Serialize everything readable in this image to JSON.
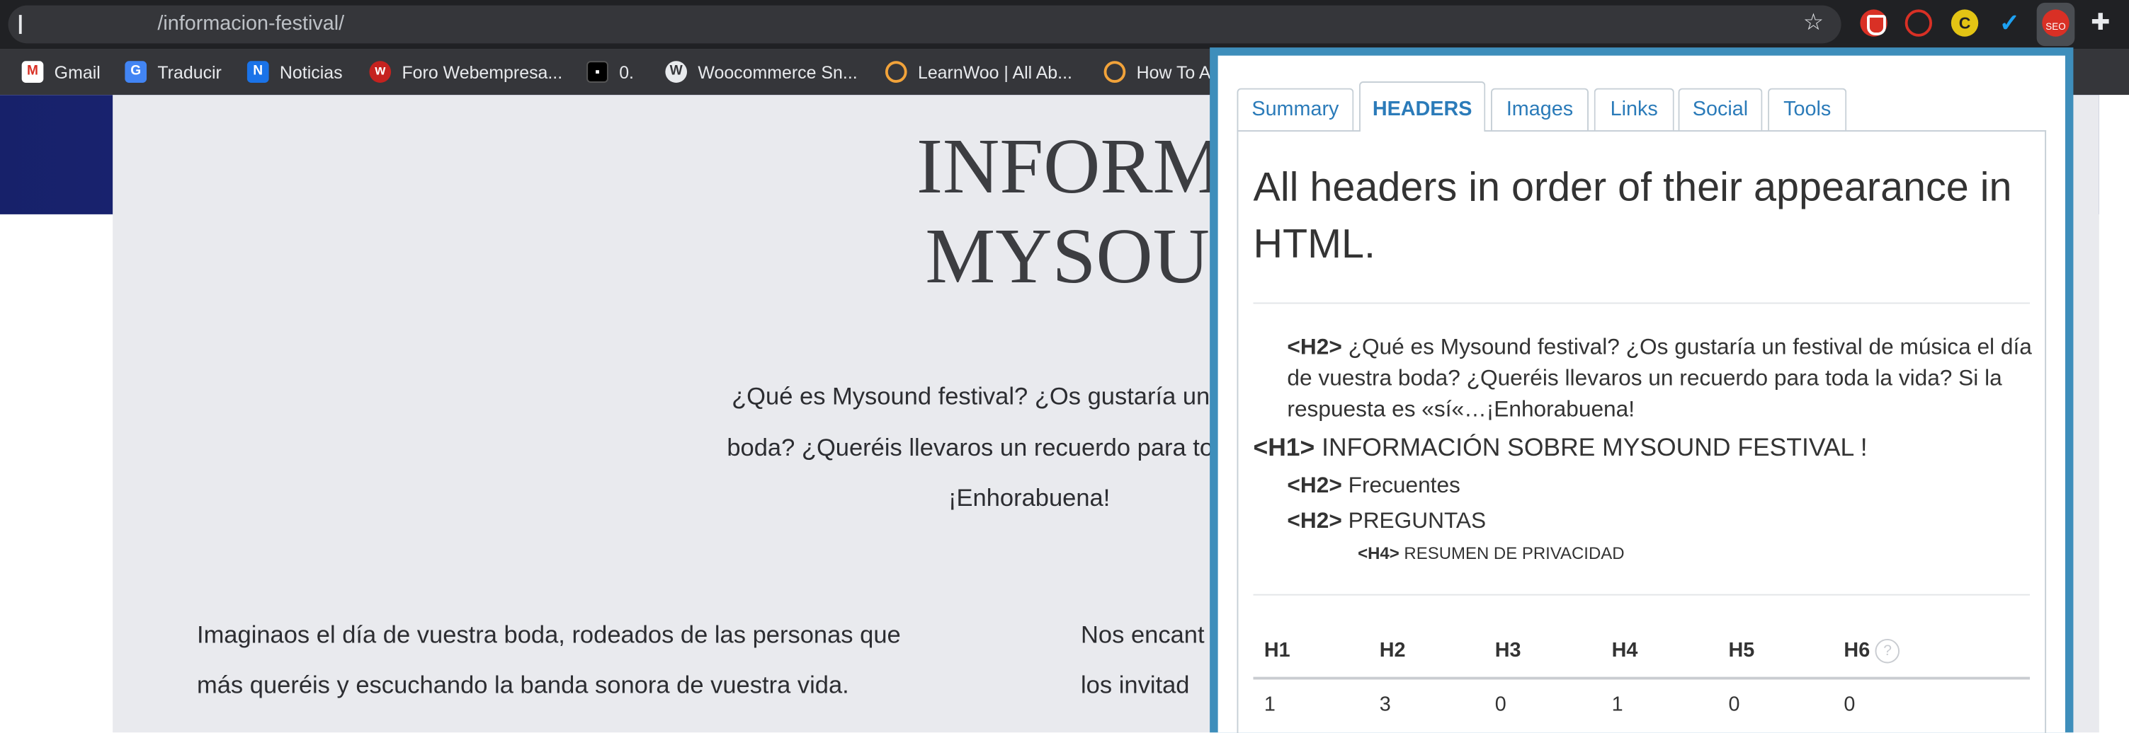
{
  "browser": {
    "url": "/informacion-festival/",
    "icons": [
      "star-icon",
      "brave-shield-icon",
      "search-extension-icon",
      "c-extension-icon",
      "check-extension-icon",
      "seo-extension-icon",
      "puzzle-icon"
    ]
  },
  "bookmarks": [
    {
      "label": "Gmail",
      "icon": "gmail-icon"
    },
    {
      "label": "Traducir",
      "icon": "translate-icon"
    },
    {
      "label": "Noticias",
      "icon": "news-icon"
    },
    {
      "label": "Foro Webempresa...",
      "icon": "forum-icon"
    },
    {
      "label": "0.",
      "icon": "dark-site-icon"
    },
    {
      "label": "Woocommerce Sn...",
      "icon": "wordpress-icon"
    },
    {
      "label": "LearnWoo | All Ab...",
      "icon": "learnwoo-icon"
    },
    {
      "label": "How To A",
      "icon": "sun-icon"
    }
  ],
  "website": {
    "title_line1": "INFORMACIÓN S",
    "title_line2": "MYSOUND FEST",
    "intro_line1": "¿Qué es Mysound festival? ¿Os gustaría un festival de",
    "intro_line2": "boda? ¿Queréis llevaros un recuerdo para toda la vida?",
    "intro_line3": "¡Enhorabuena!",
    "left_line1": "Imaginaos el día de vuestra boda, rodeados de las personas que",
    "left_line2": "más queréis y escuchando la banda sonora de vuestra vida.",
    "right_line1": "Nos encant",
    "right_line2": "los invitad"
  },
  "seo_popup": {
    "tabs": [
      "Summary",
      "HEADERS",
      "Images",
      "Links",
      "Social",
      "Tools"
    ],
    "active_tab": "HEADERS",
    "title": "All headers in order of their appearance in HTML.",
    "headers": [
      {
        "tag": "<H2>",
        "text": "¿Qué es Mysound festival? ¿Os gustaría un festival de música el día de vuestra boda? ¿Queréis llevaros un recuerdo para toda la vida? Si la respuesta es «sí«…¡Enhorabuena!"
      },
      {
        "tag": "<H1>",
        "text": "INFORMACIÓN SOBRE MYSOUND FESTIVAL !"
      },
      {
        "tag": "<H2>",
        "text": "Frecuentes"
      },
      {
        "tag": "<H2>",
        "text": "PREGUNTAS"
      },
      {
        "tag": "<H4>",
        "text": "RESUMEN DE PRIVACIDAD"
      }
    ],
    "stats": {
      "columns": [
        "H1",
        "H2",
        "H3",
        "H4",
        "H5",
        "H6"
      ],
      "values": [
        "1",
        "3",
        "0",
        "1",
        "0",
        "0"
      ],
      "help_icon": "?"
    }
  }
}
